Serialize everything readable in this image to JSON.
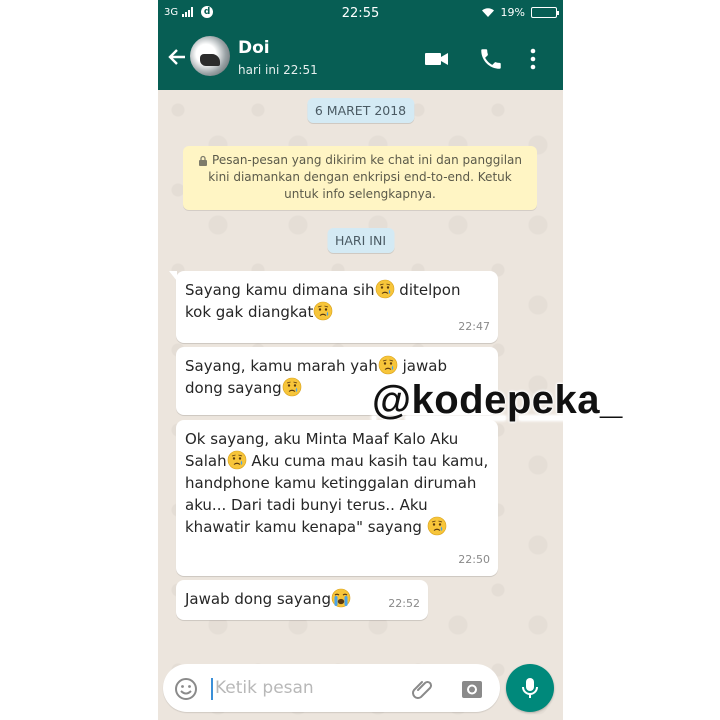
{
  "status_bar": {
    "network": "3G",
    "time": "22:55",
    "battery": "19%"
  },
  "chat_header": {
    "contact_name": "Doi",
    "last_seen": "hari ini 22:51"
  },
  "chips": {
    "date": "6 MARET 2018",
    "today": "HARI INI"
  },
  "encryption_notice": "Pesan-pesan yang dikirim ke chat ini dan panggilan kini diamankan dengan enkripsi end-to-end. Ketuk untuk info selengkapnya.",
  "messages": [
    {
      "segments": [
        "Sayang kamu dimana sih",
        "crying-face",
        " ditelpon kok gak diangkat",
        "crying-face"
      ],
      "time": "22:47"
    },
    {
      "segments": [
        "Sayang, kamu marah yah",
        "crying-face",
        " jawab dong sayang",
        "crying-face"
      ],
      "time": ""
    },
    {
      "segments": [
        "Ok sayang, aku Minta Maaf Kalo Aku Salah",
        "crying-face",
        " Aku cuma mau kasih tau kamu, handphone kamu ketinggalan dirumah aku... Dari tadi bunyi terus.. Aku khawatir kamu kenapa\" sayang ",
        "crying-face"
      ],
      "time": "22:50"
    },
    {
      "segments": [
        "Jawab dong sayang",
        "loudly-crying-face"
      ],
      "time": "22:52"
    }
  ],
  "watermark": "@kodepeka_",
  "composer": {
    "placeholder": "Ketik pesan"
  },
  "icons": {
    "back": "arrow-left-icon",
    "video": "video-call-icon",
    "call": "phone-icon",
    "menu": "more-vert-icon",
    "emoji": "emoji-icon",
    "attach": "paperclip-icon",
    "camera": "camera-icon",
    "mic": "mic-icon"
  },
  "colors": {
    "header": "#075e54",
    "chat_background": "#ece5dd",
    "bubble": "#ffffff",
    "notice": "#fff5c4",
    "date_chip": "#d4eaf4",
    "mic_button": "#00897b"
  }
}
